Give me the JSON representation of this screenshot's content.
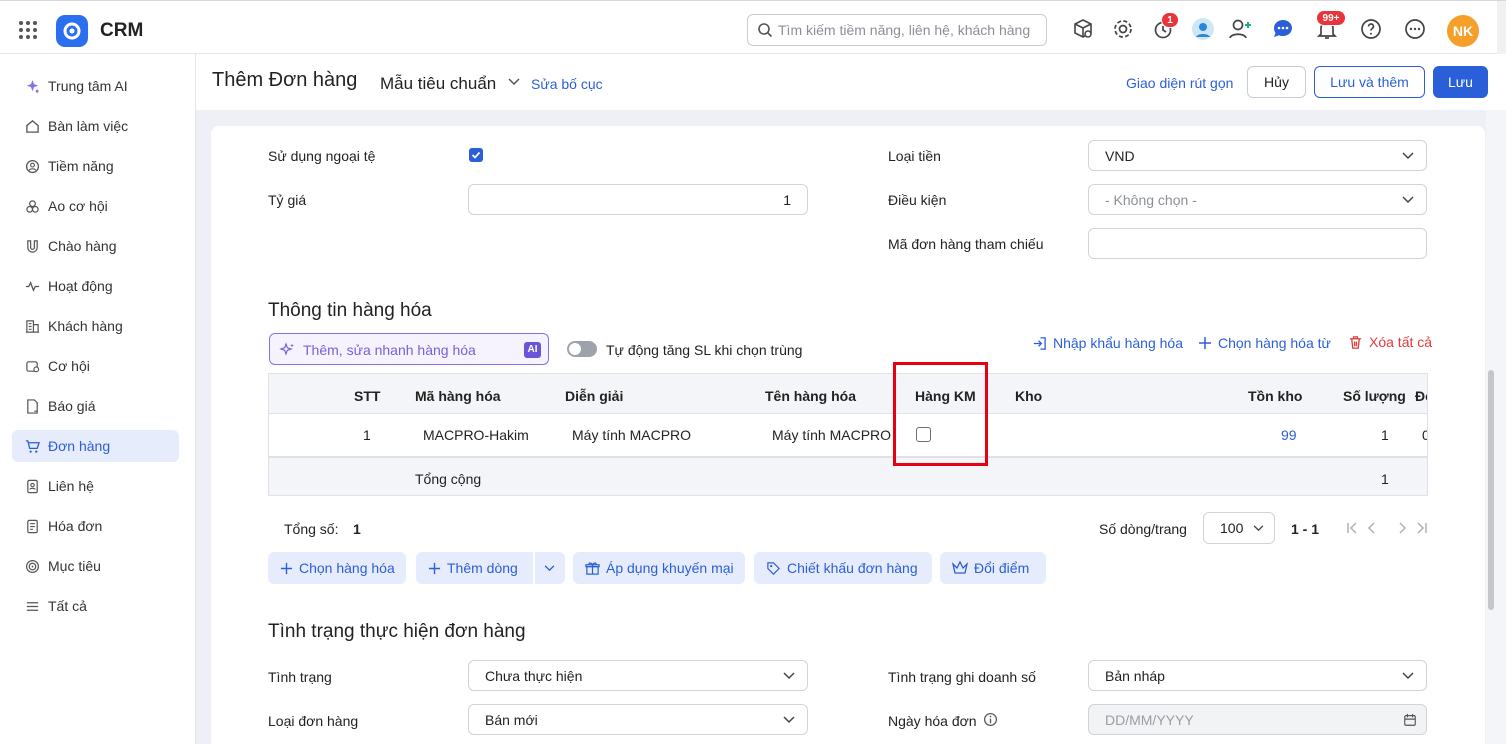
{
  "topbar": {
    "app_name": "CRM",
    "search_placeholder": "Tìm kiếm tiềm năng, liên hệ, khách hàng",
    "timer_badge": "1",
    "notif_badge": "99+",
    "user_initials": "NK"
  },
  "sidebar": {
    "items": [
      {
        "label": "Trung tâm AI",
        "icon": "ai-sparkle-icon"
      },
      {
        "label": "Bàn làm việc",
        "icon": "home-icon"
      },
      {
        "label": "Tiềm năng",
        "icon": "target-person-icon"
      },
      {
        "label": "Ao cơ hội",
        "icon": "opportunity-pool-icon"
      },
      {
        "label": "Chào hàng",
        "icon": "magnet-icon"
      },
      {
        "label": "Hoạt động",
        "icon": "activity-icon"
      },
      {
        "label": "Khách hàng",
        "icon": "building-icon"
      },
      {
        "label": "Cơ hội",
        "icon": "opportunity-icon"
      },
      {
        "label": "Báo giá",
        "icon": "quote-icon"
      },
      {
        "label": "Đơn hàng",
        "icon": "cart-icon"
      },
      {
        "label": "Liên hệ",
        "icon": "contact-icon"
      },
      {
        "label": "Hóa đơn",
        "icon": "invoice-icon"
      },
      {
        "label": "Mục tiêu",
        "icon": "goal-icon"
      },
      {
        "label": "Tất cả",
        "icon": "menu-icon"
      }
    ],
    "active_index": 9
  },
  "header": {
    "title": "Thêm Đơn hàng",
    "template": "Mẫu tiêu chuẩn",
    "edit_layout": "Sửa bố cục",
    "compact_view": "Giao diện rút gọn",
    "cancel": "Hủy",
    "save_and_add": "Lưu và thêm",
    "save": "Lưu"
  },
  "form": {
    "foreign_currency_label": "Sử dụng ngoại tệ",
    "foreign_currency_checked": true,
    "exchange_rate_label": "Tỷ giá",
    "exchange_rate_value": "1",
    "currency_label": "Loại tiền",
    "currency_value": "VND",
    "condition_label": "Điều kiện",
    "condition_value": "- Không chọn -",
    "ref_order_label": "Mã đơn hàng tham chiếu",
    "ref_order_value": ""
  },
  "goods": {
    "section_title": "Thông tin hàng hóa",
    "ai_placeholder": "Thêm, sửa nhanh hàng hóa",
    "ai_tag": "AI",
    "auto_increase_label": "Tự động tăng SL khi chọn trùng",
    "import_link": "Nhập khẩu hàng hóa",
    "choose_from_link": "Chọn hàng hóa từ",
    "delete_all_link": "Xóa tất cả",
    "columns": [
      "STT",
      "Mã hàng hóa",
      "Diễn giải",
      "Tên hàng hóa",
      "Hàng KM",
      "Kho",
      "Tồn kho",
      "Số lượng",
      "Đơ"
    ],
    "rows": [
      {
        "stt": "1",
        "code": "MACPRO-Hakim",
        "description": "Máy tính MACPRO",
        "name": "Máy tính MACPRO",
        "promo": false,
        "warehouse": "",
        "stock": "99",
        "qty": "1",
        "extra": "0"
      }
    ],
    "total_label": "Tổng cộng",
    "total_qty": "1",
    "count_label": "Tổng số:",
    "count_value": "1",
    "rows_per_page_label": "Số dòng/trang",
    "rows_per_page": "100",
    "page_range": "1 - 1",
    "actions": {
      "choose_goods": "Chọn hàng hóa",
      "add_row": "Thêm dòng",
      "apply_promo": "Áp dụng khuyến mại",
      "order_discount": "Chiết khấu đơn hàng",
      "redeem_points": "Đổi điểm"
    }
  },
  "status": {
    "section_title": "Tình trạng thực hiện đơn hàng",
    "status_label": "Tình trạng",
    "status_value": "Chưa thực hiện",
    "sales_status_label": "Tình trạng ghi doanh số",
    "sales_status_value": "Bản nháp",
    "order_type_label": "Loại đơn hàng",
    "order_type_value": "Bán mới",
    "invoice_date_label": "Ngày hóa đơn",
    "invoice_date_placeholder": "DD/MM/YYYY"
  },
  "colors": {
    "accent": "#2b5fd9",
    "highlight": "#e60012",
    "danger": "#e03a3a"
  }
}
